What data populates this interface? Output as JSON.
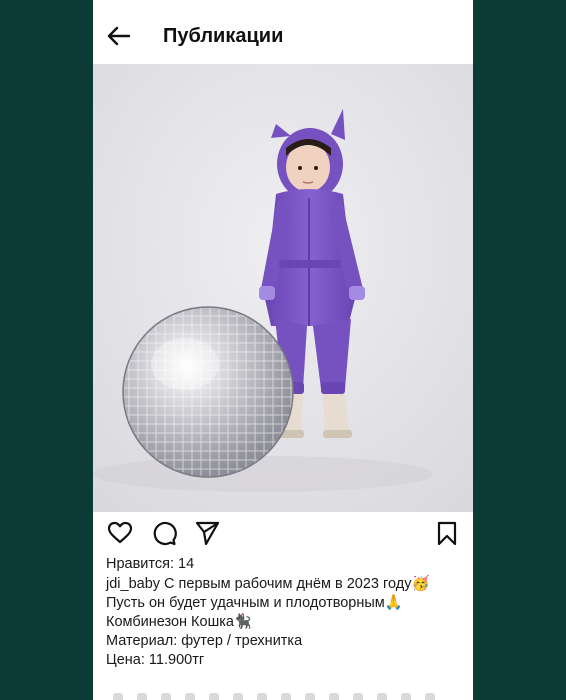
{
  "header": {
    "title": "Публикации",
    "back_icon": "arrow-left-icon"
  },
  "post": {
    "image_icon": "photo-child-purple-jumpsuit-disco-ball",
    "actions": {
      "like_icon": "heart-icon",
      "comment_icon": "comment-icon",
      "share_icon": "send-icon",
      "save_icon": "bookmark-icon"
    },
    "likes_text": "Нравится: 14",
    "caption": {
      "line1": "jdi_baby С первым рабочим днём в 2023 году🥳",
      "line2": "Пусть он будет удачным и плодотворным🙏",
      "line3": "Комбинезон Кошка🐈‍⬛",
      "line4": "Материал: футер / трехнитка",
      "line5": "Цена: 11.900тг"
    }
  },
  "colors": {
    "page_bg": "#0b3a37",
    "panel_bg": "#ffffff",
    "jumpsuit": "#7b55c6",
    "photo_bg": "#e7e6ea"
  }
}
